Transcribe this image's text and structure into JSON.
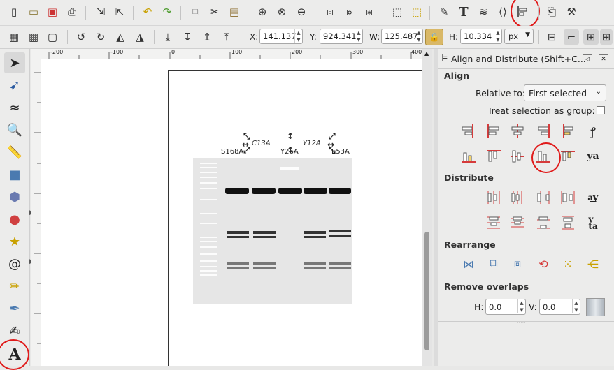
{
  "toolbar1": {
    "icons": [
      "new-file-icon",
      "open-file-icon",
      "save-icon",
      "print-icon",
      "import-icon",
      "export-icon",
      "undo-icon",
      "redo-icon",
      "duplicate-icon",
      "cut-icon",
      "paste-icon",
      "zoom-selection-icon",
      "zoom-drawing-icon",
      "zoom-page-icon",
      "duplicate-object-icon",
      "group-icon",
      "ungroup-icon",
      "clone-icon",
      "unlink-clone-icon",
      "fill-stroke-icon",
      "text-font-icon",
      "layers-icon",
      "xml-editor-icon",
      "align-distribute-icon",
      "document-properties-icon",
      "preferences-icon"
    ]
  },
  "toolbar2": {
    "x_label": "X:",
    "x_value": "141.137",
    "y_label": "Y:",
    "y_value": "924.341",
    "w_label": "W:",
    "w_value": "125.487",
    "h_label": "H:",
    "h_value": "10.334",
    "unit": "px"
  },
  "ruler": {
    "ticks": [
      "-200",
      "-100",
      "0",
      "100",
      "200",
      "300",
      "400"
    ]
  },
  "canvas": {
    "labels_top": [
      "C13A",
      "Y12A"
    ],
    "labels_bottom": [
      "S168A",
      "Y26A",
      "E53A"
    ]
  },
  "panel": {
    "title": "Align and Distribute (Shift+C...",
    "align_heading": "Align",
    "relative_to_label": "Relative to:",
    "relative_to_value": "First selected",
    "treat_group_label": "Treat selection as group:",
    "distribute_heading": "Distribute",
    "rearrange_heading": "Rearrange",
    "remove_overlaps_heading": "Remove overlaps",
    "h_label": "H:",
    "h_value": "0.0",
    "v_label": "V:",
    "v_value": "0.0"
  },
  "colors": {
    "highlight_circle": "#e01b1b",
    "accent": "#d63b3b"
  }
}
